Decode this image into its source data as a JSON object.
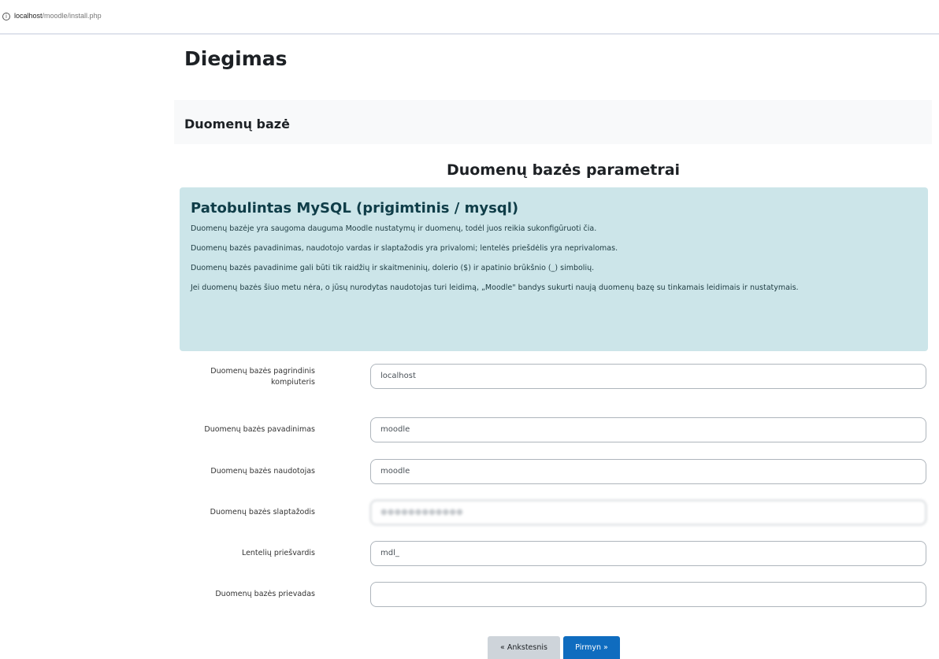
{
  "browser": {
    "url_host": "localhost",
    "url_path": "/moodle/install.php",
    "info_icon": "info-circle-icon"
  },
  "page": {
    "title": "Diegimas",
    "section_title": "Duomenų bazė",
    "params_title": "Duomenų bazės parametrai"
  },
  "info_box": {
    "title": "Patobulintas MySQL (prigimtinis / mysql)",
    "paragraphs": [
      "Duomenų bazėje yra saugoma dauguma Moodle nustatymų ir duomenų, todėl juos reikia sukonfigūruoti čia.",
      "Duomenų bazės pavadinimas, naudotojo vardas ir slaptažodis yra privalomi; lentelės priešdėlis yra neprivalomas.",
      "Duomenų bazės pavadinime gali būti tik raidžių ir skaitmeninių, dolerio ($) ir apatinio brūkšnio (_) simbolių.",
      "Jei duomenų bazės šiuo metu nėra, o jūsų nurodytas naudotojas turi leidimą, „Moodle\" bandys sukurti naują duomenų bazę su tinkamais leidimais ir nustatymais."
    ]
  },
  "form": {
    "host_label": "Duomenų bazės pagrindinis kompiuteris",
    "host_value": "localhost",
    "name_label": "Duomenų bazės pavadinimas",
    "name_value": "moodle",
    "user_label": "Duomenų bazės naudotojas",
    "user_value": "moodle",
    "password_label": "Duomenų bazės slaptažodis",
    "prefix_label": "Lentelių priešvardis",
    "prefix_value": "mdl_",
    "port_label": "Duomenų bazės prievadas",
    "port_value": ""
  },
  "buttons": {
    "prev_label": "« Ankstesnis",
    "next_label": "Pirmyn »"
  },
  "colors": {
    "info_bg": "#cce5e9",
    "primary": "#0f6cbf",
    "secondary": "#ced4da"
  }
}
